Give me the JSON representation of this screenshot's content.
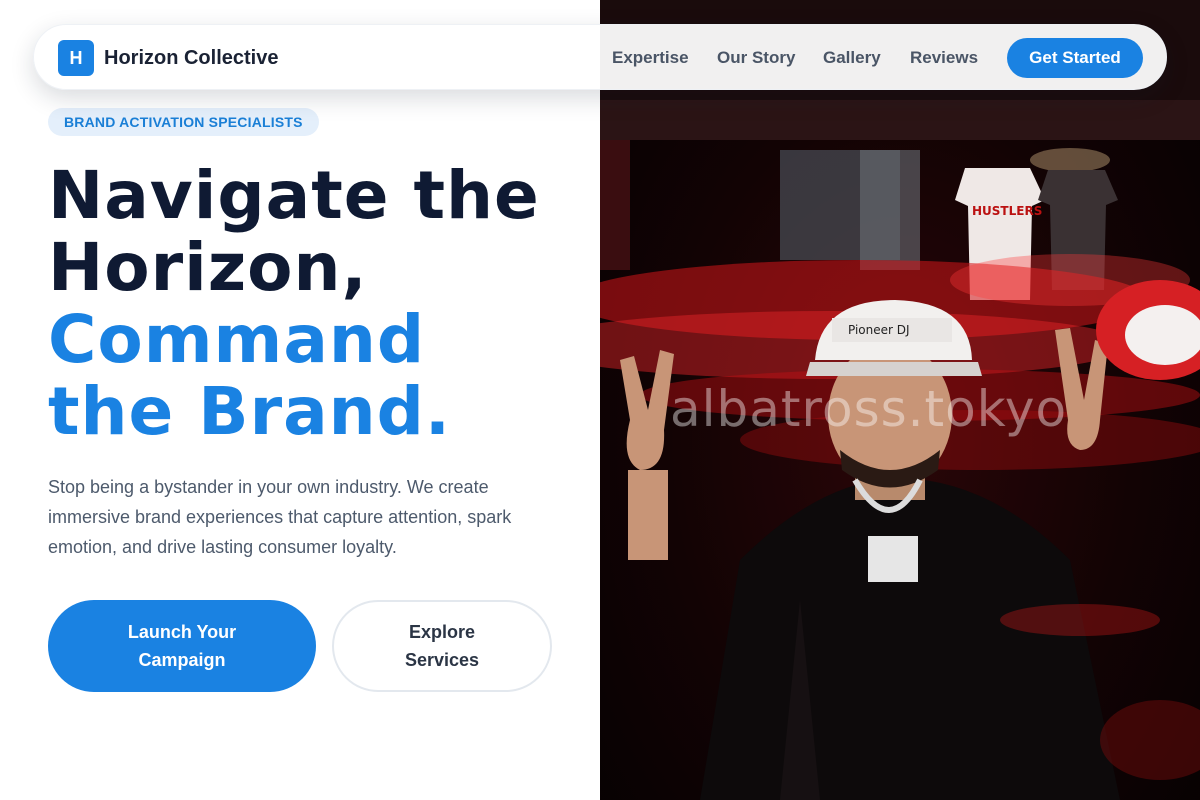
{
  "nav": {
    "logo_letter": "H",
    "brand": "Horizon Collective",
    "links": [
      "Expertise",
      "Our Story",
      "Gallery",
      "Reviews"
    ],
    "cta": "Get Started"
  },
  "hero": {
    "badge": "BRAND ACTIVATION SPECIALISTS",
    "headline_lines": [
      "Navigate the",
      "Horizon,",
      "Command",
      "the Brand."
    ],
    "subtext": "Stop being a bystander in your own industry. We create immersive brand experiences that capture attention, spark emotion, and drive lasting consumer loyalty.",
    "primary_button": "Launch Your Campaign",
    "secondary_button": "Explore Services"
  },
  "image": {
    "watermark": "albatross.tokyo",
    "shirt_text": "HUSTLERS",
    "cap_text": "Pioneer DJ"
  },
  "colors": {
    "accent": "#1a82e2",
    "heading": "#0f1a33",
    "badge_bg": "#e4effb"
  }
}
